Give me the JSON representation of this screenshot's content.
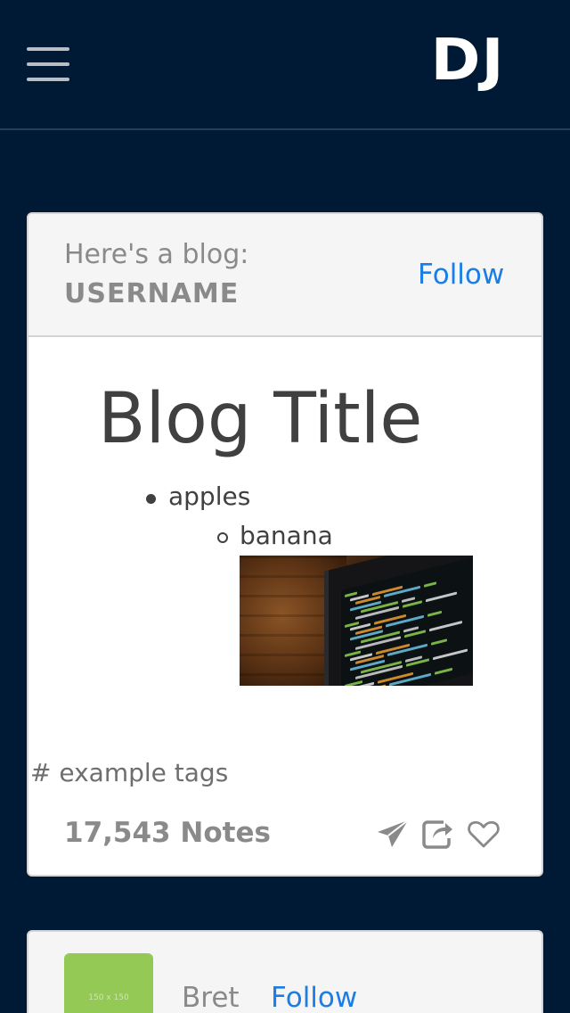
{
  "navbar": {
    "menu_icon": "hamburger-menu-icon",
    "logo_text": "DJ"
  },
  "post": {
    "header_text": "Here's a blog:",
    "username": "USERNAME",
    "follow_label": "Follow",
    "blog_title": "Blog Title",
    "list": {
      "item1": "apples",
      "item2": "banana"
    },
    "image": "code-screen-photo",
    "tags": "# example tags",
    "notes": "17,543 Notes",
    "actions": [
      "send-icon",
      "share-icon",
      "heart-icon"
    ]
  },
  "suggestion": {
    "avatar_label": "150 x 150",
    "name": "Bret",
    "follow_label": "Follow"
  },
  "colors": {
    "background": "#001a35",
    "link": "#1a7ee5",
    "muted_text": "#8a8a8a",
    "avatar": "#93c954"
  }
}
